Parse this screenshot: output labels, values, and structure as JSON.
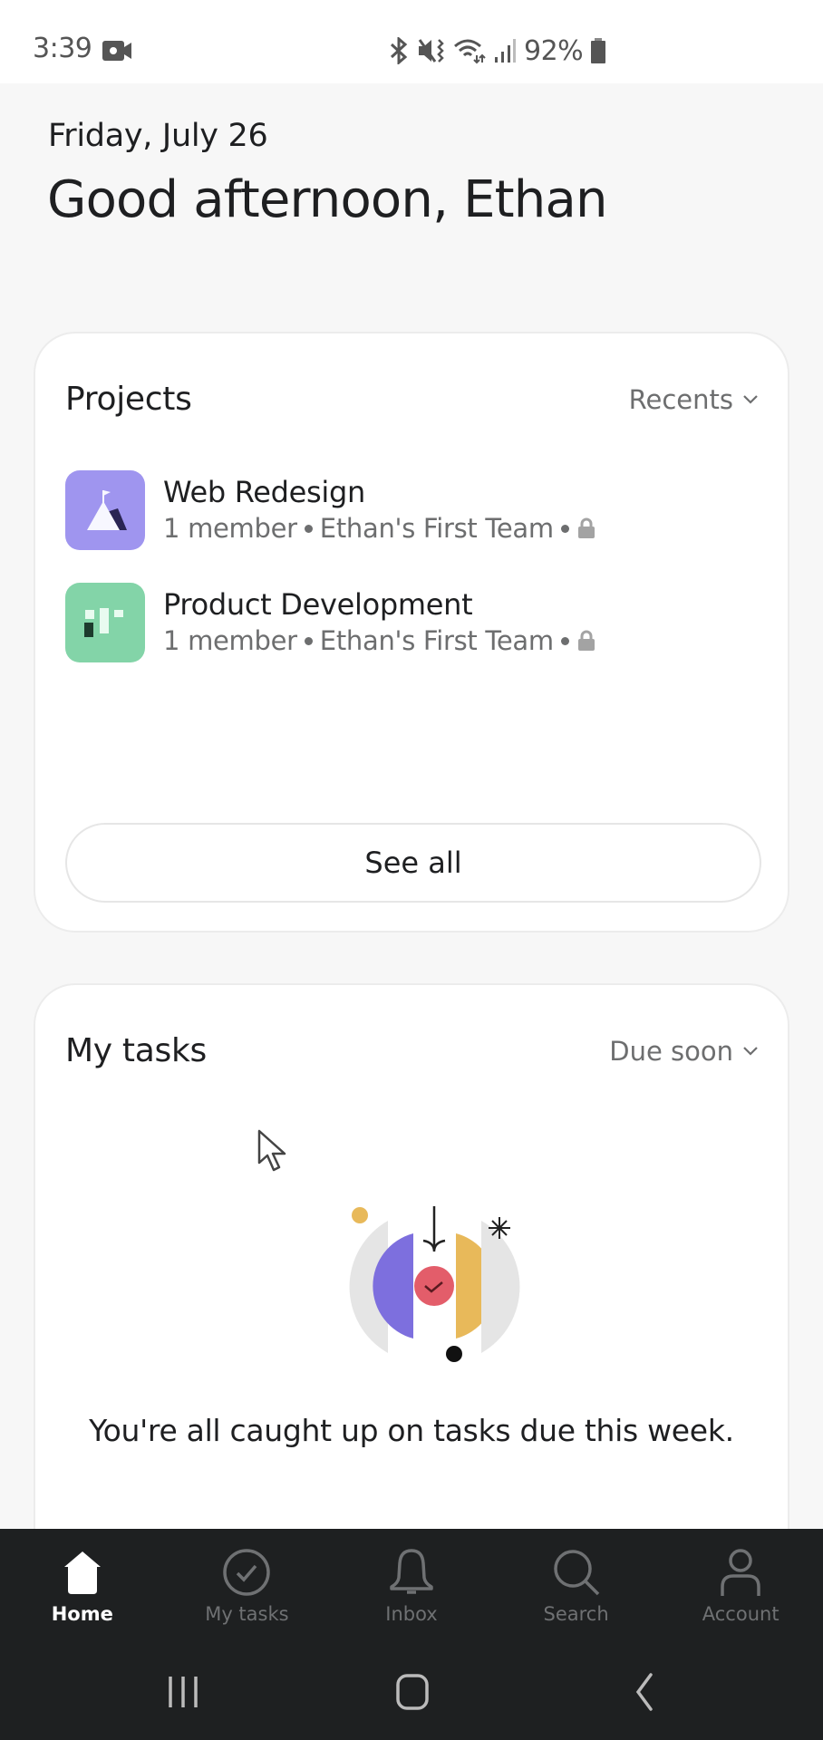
{
  "status_bar": {
    "time": "3:39",
    "battery": "92%",
    "icons": [
      "video-record-icon",
      "bluetooth-icon",
      "mute-vibrate-icon",
      "wifi-icon",
      "signal-icon",
      "battery-icon"
    ]
  },
  "header": {
    "date": "Friday, July 26",
    "greeting": "Good afternoon, Ethan"
  },
  "projects_card": {
    "title": "Projects",
    "filter_label": "Recents",
    "projects": [
      {
        "name": "Web Redesign",
        "members": "1 member",
        "team": "Ethan's First Team",
        "privacy": "lock-icon",
        "icon": "mountain-flag-icon",
        "color": "#9f95ef"
      },
      {
        "name": "Product Development",
        "members": "1 member",
        "team": "Ethan's First Team",
        "privacy": "lock-icon",
        "icon": "board-icon",
        "color": "#83d4a8"
      }
    ],
    "see_all_label": "See all"
  },
  "tasks_card": {
    "title": "My tasks",
    "filter_label": "Due soon",
    "empty_message": "You're all caught up on tasks due this week."
  },
  "bottom_nav": {
    "items": [
      {
        "label": "Home",
        "icon": "home-icon",
        "active": true
      },
      {
        "label": "My tasks",
        "icon": "check-circle-icon",
        "active": false
      },
      {
        "label": "Inbox",
        "icon": "bell-icon",
        "active": false
      },
      {
        "label": "Search",
        "icon": "search-icon",
        "active": false
      },
      {
        "label": "Account",
        "icon": "person-icon",
        "active": false
      }
    ]
  },
  "colors": {
    "background": "#f7f7f7",
    "card": "#ffffff",
    "nav_background": "#1e2021",
    "web_redesign": "#9f95ef",
    "product_development": "#83d4a8"
  }
}
